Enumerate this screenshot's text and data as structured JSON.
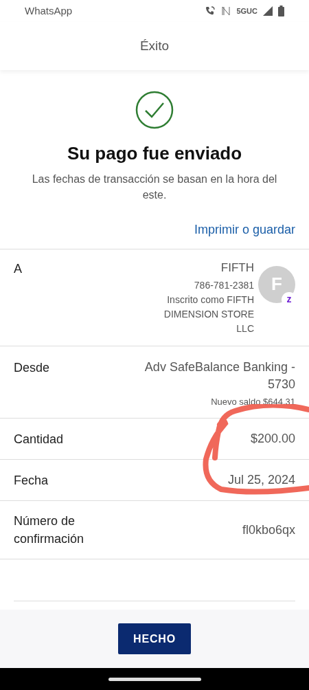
{
  "status_bar": {
    "app": "WhatsApp",
    "network": "5GUC"
  },
  "header": {
    "title": "Éxito"
  },
  "success": {
    "title": "Su pago fue enviado",
    "subtitle": "Las fechas de transacción se basan en la hora del este."
  },
  "print_link": "Imprimir o guardar",
  "details": [
    {
      "kind": "recipient",
      "label": "A",
      "name": "FIFTH",
      "phone": "786-781-2381",
      "enrolled": "Inscrito como FIFTH DIMENSION STORE LLC",
      "avatar": "F",
      "badge": "z"
    },
    {
      "kind": "account",
      "label": "Desde",
      "value": "Adv SafeBalance Banking - 5730",
      "note": "Nuevo saldo $644.31"
    },
    {
      "kind": "plain",
      "label": "Cantidad",
      "value": "$200.00"
    },
    {
      "kind": "plain",
      "label": "Fecha",
      "value": "Jul 25, 2024"
    },
    {
      "kind": "plain",
      "label": "Número de confirmación",
      "value": "fl0kbo6qx"
    }
  ],
  "done_button": "HECHO"
}
